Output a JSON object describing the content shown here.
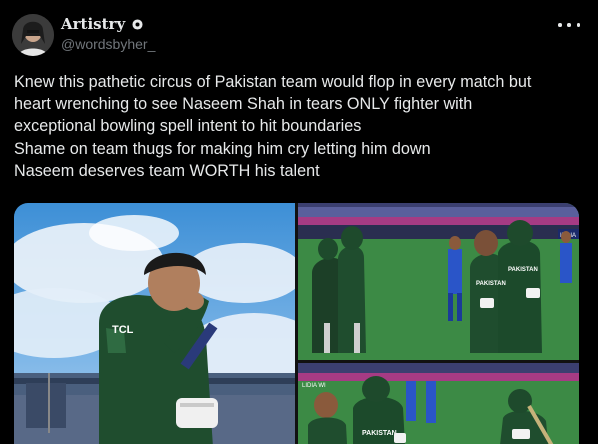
{
  "author": {
    "display_name": "Artistry",
    "handle": "@wordsbyher_",
    "avatar_icon": "avatar-photo",
    "badge_icon": "gear-badge-icon"
  },
  "more_icon": "more-options-icon",
  "tweet": {
    "lines": [
      "Knew this pathetic circus of Pakistan team would flop in every match but",
      "heart wrenching to see Naseem Shah in tears ONLY fighter with",
      "exceptional bowling spell intent to hit boundaries",
      "Shame on team thugs for making him cry letting him down",
      "Naseem deserves team WORTH his talent"
    ]
  },
  "media": {
    "jersey_text_tcl": "TCL",
    "jersey_text_pakistan_1": "PAKISTAN",
    "jersey_text_pakistan_2": "PAKISTAN",
    "jersey_text_pakistan_3": "PAKISTAN",
    "scoreboard_text": "INDIA",
    "board_text": "LIDIA WI"
  },
  "colors": {
    "background": "#000000",
    "text": "#e7e9ea",
    "secondary_text": "#71767b",
    "jersey_green": "#1f4d2e"
  }
}
